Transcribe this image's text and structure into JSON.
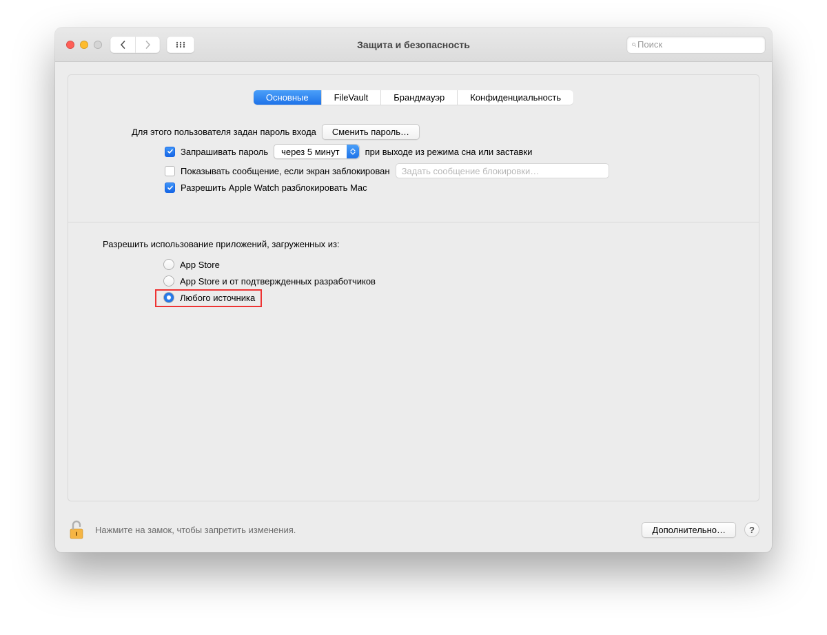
{
  "window": {
    "title": "Защита и безопасность",
    "search_placeholder": "Поиск"
  },
  "tabs": {
    "general": "Основные",
    "filevault": "FileVault",
    "firewall": "Брандмауэр",
    "privacy": "Конфиденциальность"
  },
  "general": {
    "password_set_prefix": "Для этого пользователя задан пароль входа",
    "change_password_btn": "Сменить пароль…",
    "require_password_label": "Запрашивать пароль",
    "require_password_delay": "через 5 минут",
    "require_password_suffix": "при выходе из режима сна или заставки",
    "show_message_label": "Показывать сообщение, если экран заблокирован",
    "set_lock_message_btn": "Задать сообщение блокировки…",
    "allow_apple_watch_label": "Разрешить Apple Watch разблокировать Mac"
  },
  "gatekeeper": {
    "heading": "Разрешить использование приложений, загруженных из:",
    "options": {
      "app_store": "App Store",
      "identified": "App Store и от подтвержденных разработчиков",
      "anywhere": "Любого источника"
    }
  },
  "footer": {
    "lock_hint": "Нажмите на замок, чтобы запретить изменения.",
    "advanced_btn": "Дополнительно…",
    "help_label": "?"
  }
}
